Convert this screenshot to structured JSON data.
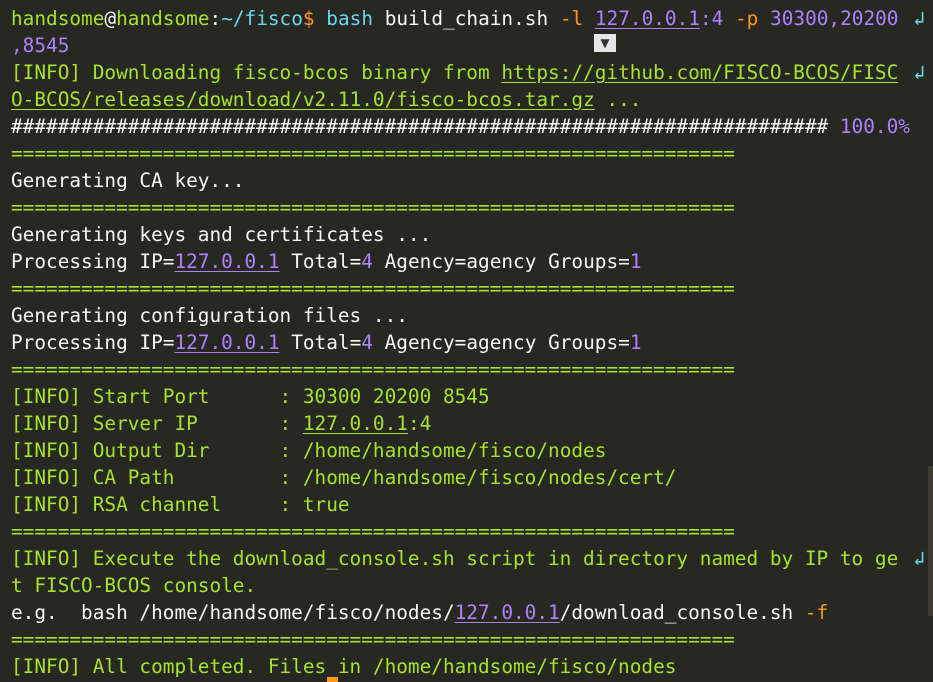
{
  "prompt": {
    "user": "handsome",
    "at": "@",
    "host": "handsome",
    "path_sep": ":",
    "cwd": "~/fisco",
    "symbol": "$",
    "cmd": "bash",
    "arg_script": "build_chain.sh",
    "flag_l": "-l",
    "ip_arg": "127.0.0.1",
    "ip_suffix": ":4",
    "flag_p": "-p",
    "ports_first": "30300,20200",
    "ports_wrap": ",8545"
  },
  "wrap_glyph": "↲",
  "dropdown_glyph": "▼",
  "lines": {
    "info_prefix": "[INFO]",
    "download_text": " Downloading fisco-bcos binary from ",
    "download_url_1": "https://github.com/FISCO-BCOS/FISC",
    "download_url_2": "O-BCOS/releases/download/v2.11.0/fisco-bcos.tar.gz",
    "download_tail": " ...",
    "progress_hashes": "######################################################################",
    "progress_pct": " 100.0%",
    "separator": "==============================================================",
    "gen_ca": "Generating CA key...",
    "gen_keys": "Generating keys and certificates ...",
    "processing_ip_label": "Processing IP=",
    "processing_ip": "127.0.0.1",
    "total_label": " Total=",
    "total_val": "4",
    "agency_label": " Agency=",
    "agency_val": "agency",
    "groups_label": " Groups=",
    "groups_val": "1",
    "gen_config": "Generating configuration files ...",
    "start_port_label": " Start Port      : ",
    "start_port_val": "30300 20200 8545",
    "server_ip_label": " Server IP       : ",
    "server_ip_val": "127.0.0.1",
    "server_ip_suffix": ":4",
    "output_dir_label": " Output Dir      : ",
    "output_dir_val": "/home/handsome/fisco/nodes",
    "ca_path_label": " CA Path         : ",
    "ca_path_val": "/home/handsome/fisco/nodes/cert/",
    "rsa_label": " RSA channel     : ",
    "rsa_val": "true",
    "exec_1": " Execute the download_console.sh script in directory named by IP to ge",
    "exec_2": "t FISCO-BCOS console.",
    "eg_prefix": "e.g.  bash /home/handsome/fisco/nodes/",
    "eg_ip": "127.0.0.1",
    "eg_suffix": "/download_console.sh ",
    "eg_flag": "-f",
    "completed": " All completed. Files in /home/handsome/fisco/nodes"
  },
  "colors": {
    "background": "#272822",
    "foreground": "#f8f8f2",
    "green": "#a6e22e",
    "cyan": "#66d9ef",
    "purple": "#ae81ff",
    "orange": "#fd971f"
  }
}
